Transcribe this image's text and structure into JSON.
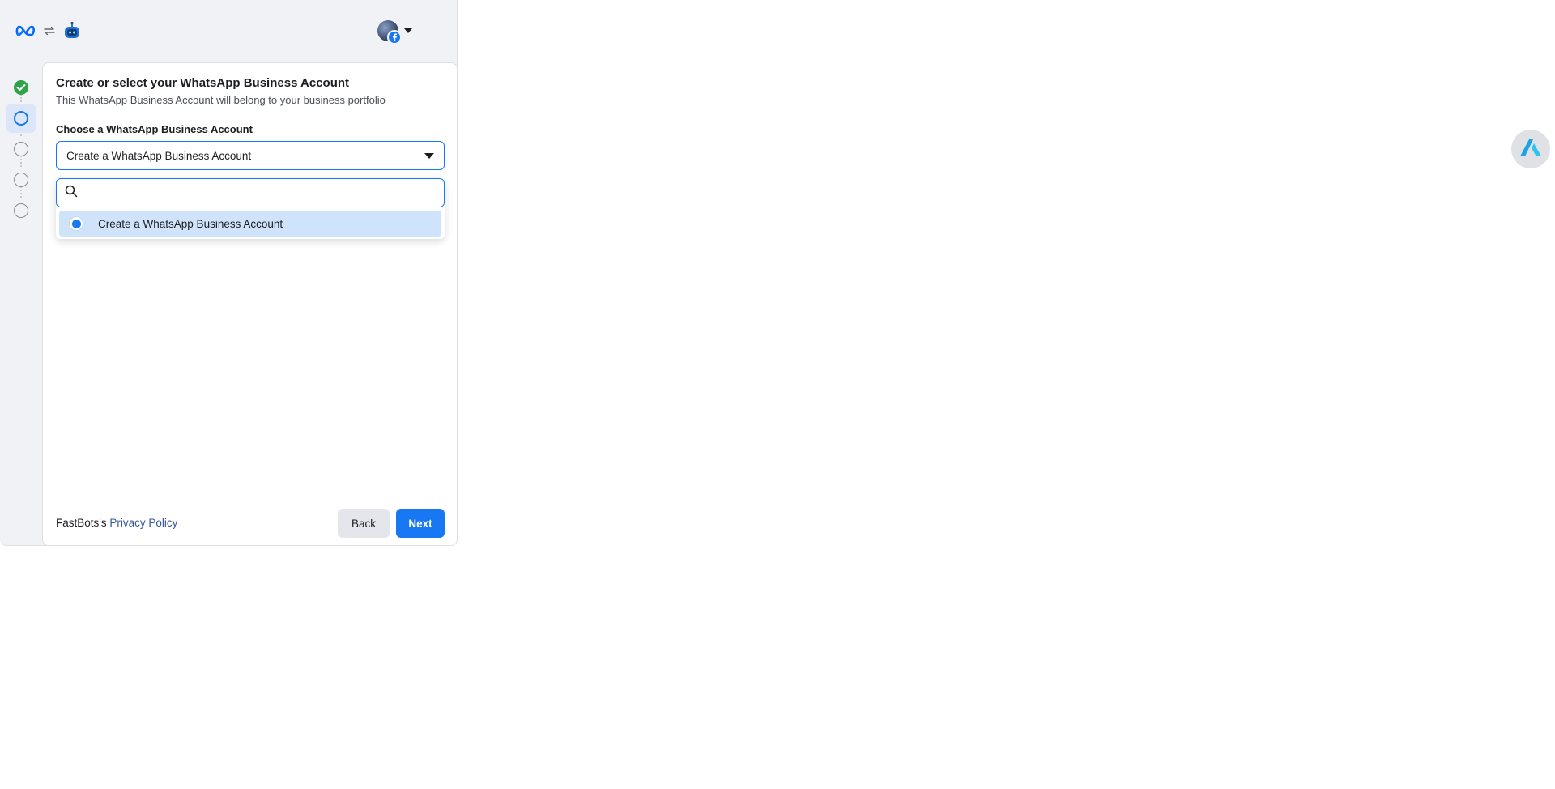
{
  "header": {
    "logo_icon": "meta-infinity-logo-icon",
    "connect_icon": "swap-arrows-icon",
    "app_icon": "fastbots-robot-icon",
    "account_avatar": "profile-avatar",
    "account_caret": "caret-down-icon"
  },
  "steps": [
    {
      "state": "done"
    },
    {
      "state": "active"
    },
    {
      "state": "pending"
    },
    {
      "state": "pending"
    },
    {
      "state": "pending"
    }
  ],
  "card": {
    "title": "Create or select your WhatsApp Business Account",
    "subtitle": "This WhatsApp Business Account will belong to your business portfolio",
    "field_label": "Choose a WhatsApp Business Account",
    "selected_value": "Create a WhatsApp Business Account",
    "search_placeholder": "",
    "options": [
      {
        "label": "Create a WhatsApp Business Account",
        "selected": true
      }
    ]
  },
  "footer": {
    "policy_prefix": "FastBots's ",
    "policy_link": "Privacy Policy",
    "back_label": "Back",
    "next_label": "Next"
  },
  "colors": {
    "accent": "#1877f2",
    "success": "#31a24c",
    "selected_option_bg": "#cfe3fb",
    "panel_bg": "#f0f2f5"
  },
  "floating_extension": {
    "icon": "extension-a-logo-icon"
  }
}
